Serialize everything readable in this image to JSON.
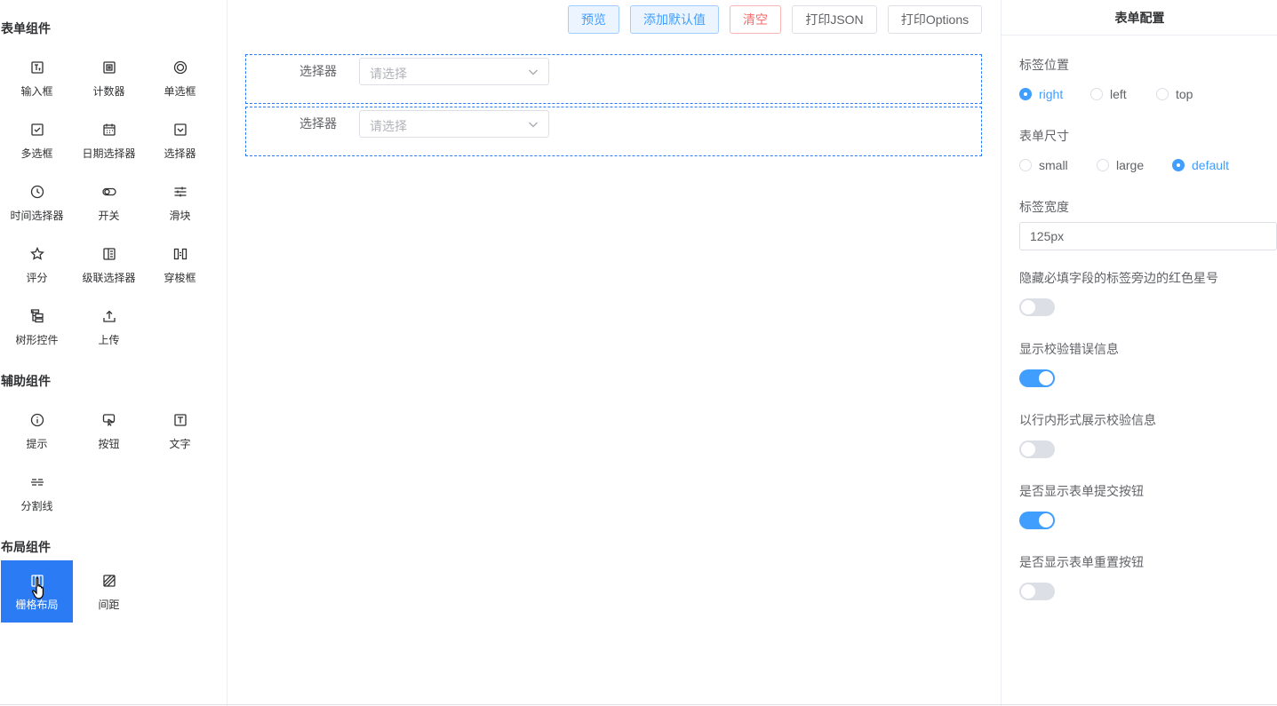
{
  "left": {
    "groups": [
      {
        "title": "表单组件",
        "items": [
          {
            "label": "输入框",
            "icon": "input-icon"
          },
          {
            "label": "计数器",
            "icon": "counter-icon"
          },
          {
            "label": "单选框",
            "icon": "radio-icon"
          },
          {
            "label": "多选框",
            "icon": "checkbox-icon"
          },
          {
            "label": "日期选择器",
            "icon": "calendar-icon"
          },
          {
            "label": "选择器",
            "icon": "select-icon"
          },
          {
            "label": "时间选择器",
            "icon": "clock-icon"
          },
          {
            "label": "开关",
            "icon": "switch-icon"
          },
          {
            "label": "滑块",
            "icon": "slider-icon"
          },
          {
            "label": "评分",
            "icon": "star-icon"
          },
          {
            "label": "级联选择器",
            "icon": "cascader-icon"
          },
          {
            "label": "穿梭框",
            "icon": "transfer-icon"
          },
          {
            "label": "树形控件",
            "icon": "tree-icon"
          },
          {
            "label": "上传",
            "icon": "upload-icon"
          }
        ]
      },
      {
        "title": "辅助组件",
        "items": [
          {
            "label": "提示",
            "icon": "info-icon"
          },
          {
            "label": "按钮",
            "icon": "button-icon"
          },
          {
            "label": "文字",
            "icon": "text-icon"
          },
          {
            "label": "分割线",
            "icon": "divider-icon"
          }
        ]
      },
      {
        "title": "布局组件",
        "items": [
          {
            "label": "栅格布局",
            "icon": "grid-icon",
            "active": true
          },
          {
            "label": "间距",
            "icon": "space-icon"
          }
        ]
      }
    ]
  },
  "toolbar": {
    "preview": "预览",
    "add_default": "添加默认值",
    "clear": "清空",
    "print_json": "打印JSON",
    "print_options": "打印Options"
  },
  "canvas": {
    "fields": [
      {
        "label": "选择器",
        "placeholder": "请选择"
      },
      {
        "label": "选择器",
        "placeholder": "请选择"
      }
    ]
  },
  "config": {
    "title": "表单配置",
    "label_position": {
      "label": "标签位置",
      "options": [
        "right",
        "left",
        "top"
      ],
      "selected": "right"
    },
    "form_size": {
      "label": "表单尺寸",
      "options": [
        "small",
        "large",
        "default"
      ],
      "selected": "default"
    },
    "label_width": {
      "label": "标签宽度",
      "value": "125px"
    },
    "hide_required_asterisk": {
      "label": "隐藏必填字段的标签旁边的红色星号",
      "on": false
    },
    "show_message": {
      "label": "显示校验错误信息",
      "on": true
    },
    "inline_message": {
      "label": "以行内形式展示校验信息",
      "on": false
    },
    "show_submit": {
      "label": "是否显示表单提交按钮",
      "on": true
    },
    "show_reset": {
      "label": "是否显示表单重置按钮",
      "on": false
    }
  },
  "colors": {
    "accent": "#409eff",
    "active_bg": "#2b7bf5",
    "danger": "#f56c6c"
  }
}
